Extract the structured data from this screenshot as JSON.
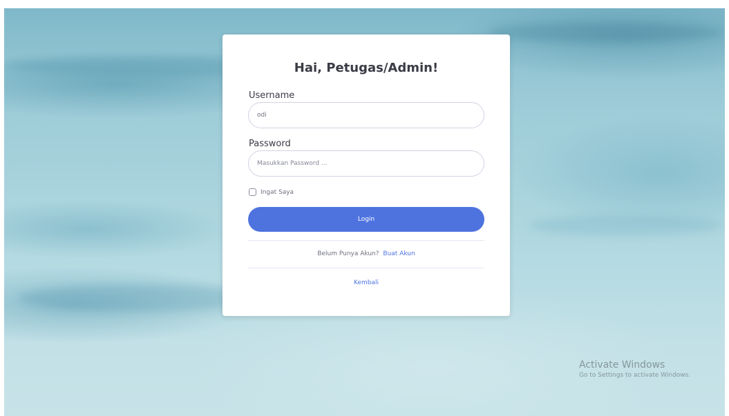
{
  "login_card": {
    "title": "Hai, Petugas/Admin!",
    "username_label": "Username",
    "username_value": "odi",
    "password_label": "Password",
    "password_placeholder": "Masukkan Password ...",
    "remember_label": "Ingat Saya",
    "login_button": "Login",
    "register_prompt": "Belum Punya Akun?",
    "register_link": "Buat Akun",
    "back_link": "Kembali"
  },
  "windows_watermark": {
    "title": "Activate Windows",
    "subtitle": "Go to Settings to activate Windows."
  },
  "colors": {
    "primary": "#4e73df",
    "card_background": "#ffffff",
    "text": "#3a3b45"
  }
}
